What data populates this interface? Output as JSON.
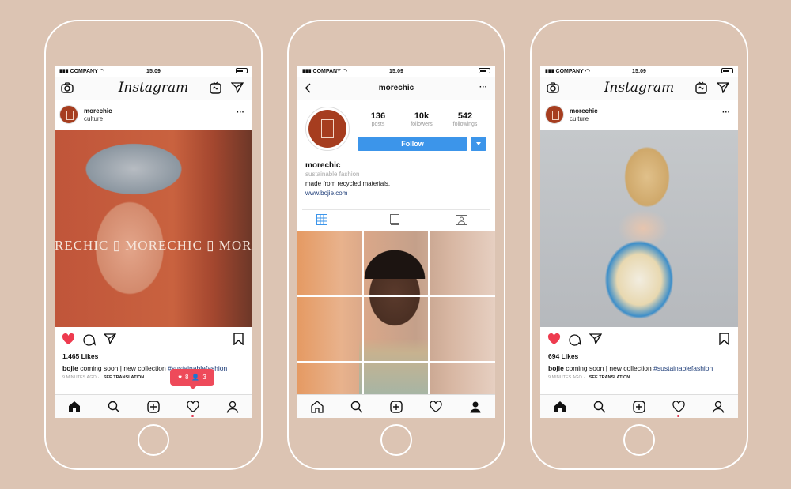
{
  "status": {
    "carrier": "COMPANY",
    "time": "15:09"
  },
  "feed1": {
    "app_title": "Instagram",
    "username": "morechic",
    "subtitle": "culture",
    "overlay_text": "RECHIC ▯ MORECHIC ▯ MORE",
    "likes": "1.465 Likes",
    "caption_user": "bojie",
    "caption_text": "coming soon | new collection",
    "caption_tag": "#sustainablefashion",
    "time_ago": "9 MINUTES AGO",
    "see_translation": "SEE TRANSLATION",
    "notification": {
      "likes": "8",
      "followers": "3"
    }
  },
  "profile": {
    "title": "morechic",
    "posts": "136",
    "posts_label": "posts",
    "followers": "10k",
    "followers_label": "followers",
    "followings": "542",
    "followings_label": "followings",
    "follow_label": "Follow",
    "name": "morechic",
    "category": "sustainable fashion",
    "bio": "made from recycled materials.",
    "website": "www.bojie.com"
  },
  "feed2": {
    "app_title": "Instagram",
    "username": "morechic",
    "subtitle": "culture",
    "likes": "694 Likes",
    "caption_user": "bojie",
    "caption_text": "coming soon | new collection",
    "caption_tag": "#sustainablefashion",
    "time_ago": "9 MINUTES AGO",
    "see_translation": "SEE TRANSLATION"
  },
  "colors": {
    "background": "#dcc4b3",
    "follow": "#3c95ea",
    "like": "#ee4a5a",
    "brand": "#a63d1f"
  }
}
